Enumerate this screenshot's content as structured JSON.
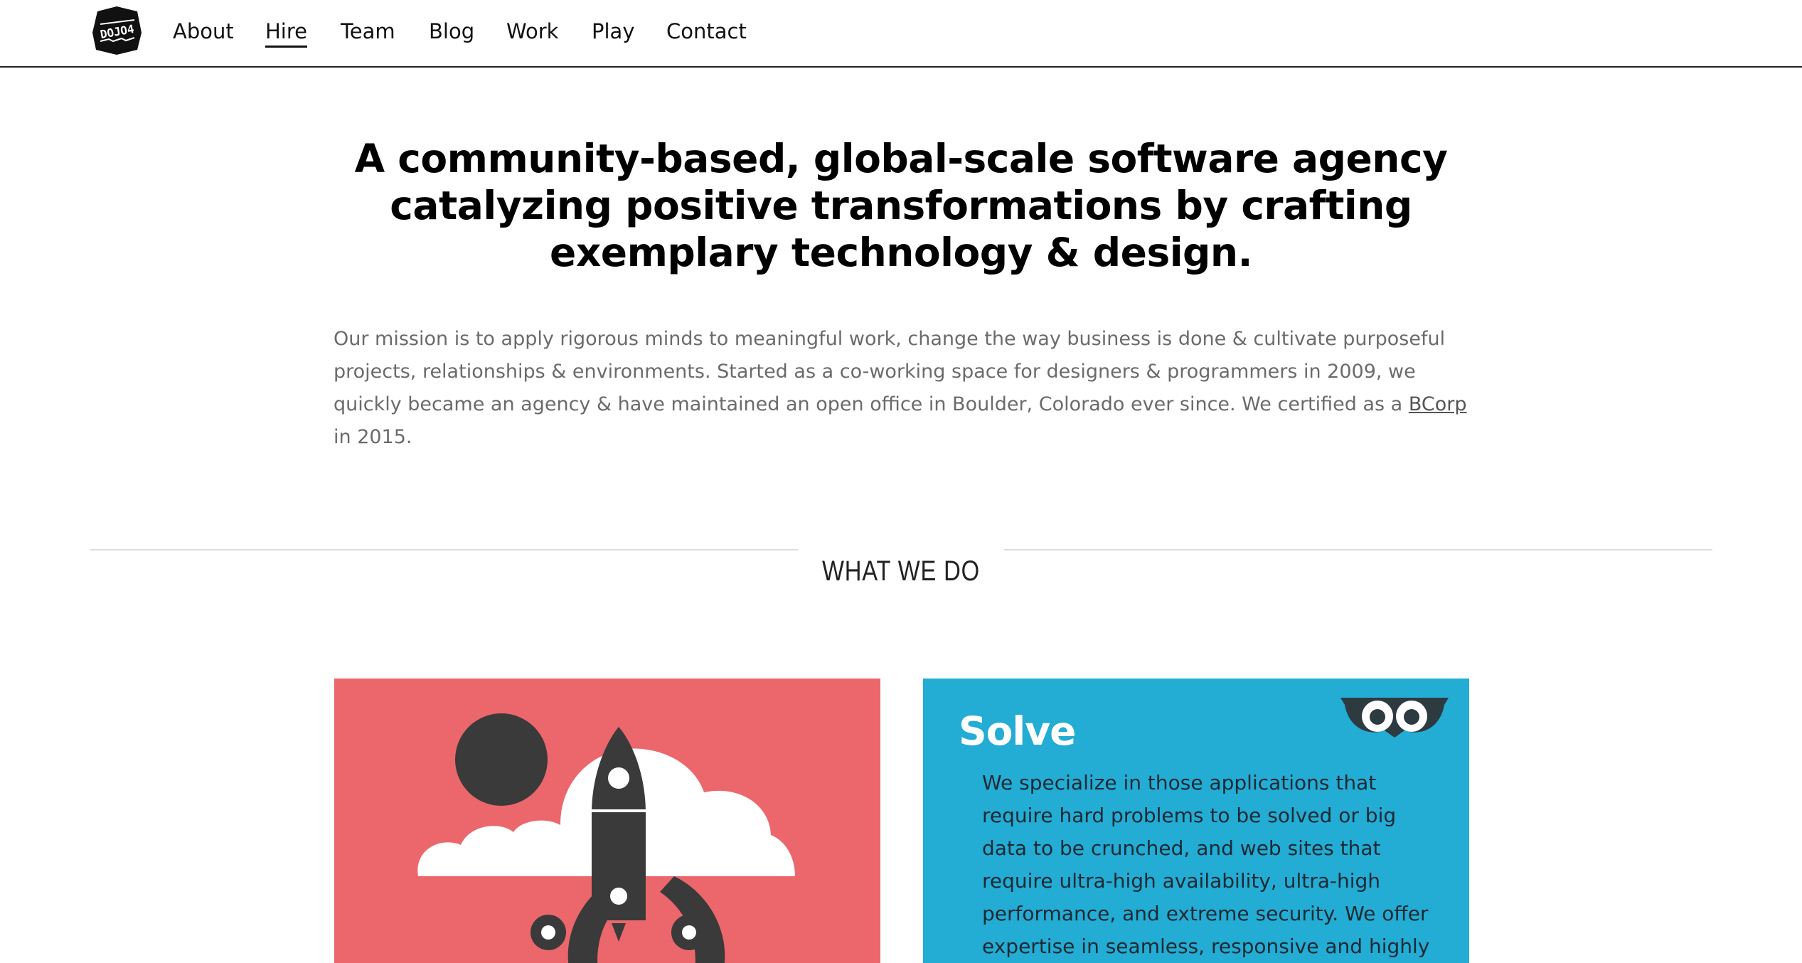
{
  "header": {
    "logo_text": "DOJO4",
    "nav": [
      {
        "label": "About"
      },
      {
        "label": "Hire",
        "active": true
      },
      {
        "label": "Team"
      },
      {
        "label": "Blog"
      },
      {
        "label": "Work"
      },
      {
        "label": "Play"
      },
      {
        "label": "Contact"
      }
    ]
  },
  "hero": {
    "headline": "A community-based, global-scale software agency catalyzing positive transformations by crafting exemplary technology & design.",
    "mission_before_link": "Our mission is to apply rigorous minds to meaningful work, change the way business is done & cultivate purposeful projects, relationships & environments. Started as a co-working space for designers & programmers in 2009, we quickly became an agency & have maintained an open office in Boulder, Colorado ever since. We certified as a ",
    "mission_link": "BCorp",
    "mission_after_link": " in 2015."
  },
  "section": {
    "title": "WHAT WE DO"
  },
  "cards": {
    "solve": {
      "title": "Solve",
      "text": "We specialize in those applications that require hard problems to be solved or big data to be crunched, and web sites that require ultra-high availability, ultra-high performance, and extreme security. We offer expertise in seamless, responsive and highly useable design."
    },
    "icons": {
      "rocket_card": "rocket-illustration",
      "solve_card": "owl-eyes-icon"
    }
  },
  "colors": {
    "red_card": "#ec676c",
    "blue_card": "#23acd4",
    "dark_art": "#3a3a3a"
  }
}
